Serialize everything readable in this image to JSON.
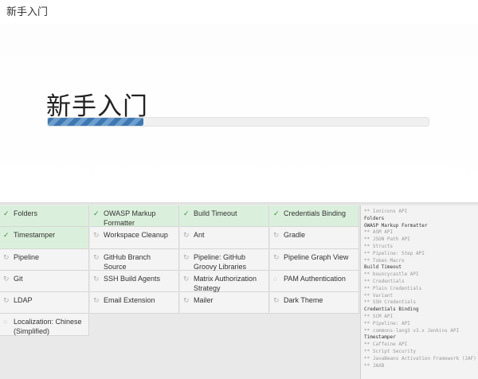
{
  "window": {
    "title": "新手入门"
  },
  "hero": {
    "title": "新手入门",
    "progress": 0.25
  },
  "icons": {
    "done": "check-icon",
    "pending": "refresh-icon",
    "idle": "circle-icon"
  },
  "plugins": [
    {
      "label": "Folders",
      "status": "done"
    },
    {
      "label": "OWASP Markup Formatter",
      "status": "done"
    },
    {
      "label": "Build Timeout",
      "status": "done"
    },
    {
      "label": "Credentials Binding",
      "status": "done"
    },
    {
      "label": "Timestamper",
      "status": "done"
    },
    {
      "label": "Workspace Cleanup",
      "status": "pending"
    },
    {
      "label": "Ant",
      "status": "pending"
    },
    {
      "label": "Gradle",
      "status": "pending"
    },
    {
      "label": "Pipeline",
      "status": "pending"
    },
    {
      "label": "GitHub Branch Source",
      "status": "pending"
    },
    {
      "label": "Pipeline: GitHub Groovy Libraries",
      "status": "pending"
    },
    {
      "label": "Pipeline Graph View",
      "status": "pending"
    },
    {
      "label": "Git",
      "status": "pending"
    },
    {
      "label": "SSH Build Agents",
      "status": "pending"
    },
    {
      "label": "Matrix Authorization Strategy",
      "status": "pending"
    },
    {
      "label": "PAM Authentication",
      "status": "idle"
    },
    {
      "label": "LDAP",
      "status": "pending"
    },
    {
      "label": "Email Extension",
      "status": "pending"
    },
    {
      "label": "Mailer",
      "status": "pending"
    },
    {
      "label": "Dark Theme",
      "status": "pending"
    },
    {
      "label": "Localization: Chinese (Simplified)",
      "status": "idle"
    }
  ],
  "log": [
    {
      "text": "** Ionicons API",
      "header": false
    },
    {
      "text": "Folders",
      "header": true
    },
    {
      "text": "OWASP Markup Formatter",
      "header": true
    },
    {
      "text": "** ASM API",
      "header": false
    },
    {
      "text": "** JSON Path API",
      "header": false
    },
    {
      "text": "** Structs",
      "header": false
    },
    {
      "text": "** Pipeline: Step API",
      "header": false
    },
    {
      "text": "** Token Macro",
      "header": false
    },
    {
      "text": "Build Timeout",
      "header": true
    },
    {
      "text": "** bouncycastle API",
      "header": false
    },
    {
      "text": "** Credentials",
      "header": false
    },
    {
      "text": "** Plain Credentials",
      "header": false
    },
    {
      "text": "** Variant",
      "header": false
    },
    {
      "text": "** SSH Credentials",
      "header": false
    },
    {
      "text": "Credentials Binding",
      "header": true
    },
    {
      "text": "** SCM API",
      "header": false
    },
    {
      "text": "** Pipeline: API",
      "header": false
    },
    {
      "text": "** commons-lang3 v3.x Jenkins API",
      "header": false
    },
    {
      "text": "Timestamper",
      "header": true
    },
    {
      "text": "** Caffeine API",
      "header": false
    },
    {
      "text": "** Script Security",
      "header": false
    },
    {
      "text": "** JavaBeans Activation Framework (JAF) API",
      "header": false
    },
    {
      "text": "** JAXB",
      "header": false
    }
  ]
}
